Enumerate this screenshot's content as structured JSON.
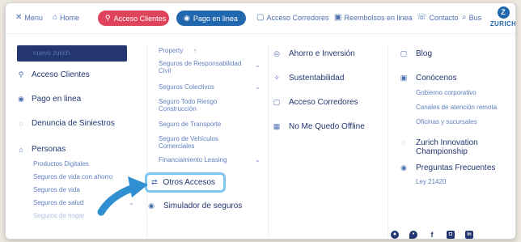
{
  "topbar": {
    "menu": "Menu",
    "home": "Home",
    "acceso_clientes": "Acceso Clientes",
    "pago_en_linea": "Pago en linea",
    "acceso_corredores": "Acceso Corredores",
    "reembolsos": "Reembolsos en linea",
    "contacto": "Contacto",
    "buscar": "Bus",
    "logo_text": "ZURICH"
  },
  "col1": {
    "header_label": "nuevo zurich",
    "items": [
      {
        "label": "Acceso Clientes",
        "icon": "person-icon"
      },
      {
        "label": "Pago en linea",
        "icon": "card-icon"
      },
      {
        "label": "Denuncia de Siniestros",
        "icon": "shield-icon"
      },
      {
        "label": "Personas",
        "icon": "people-icon"
      }
    ],
    "subitems": [
      "Productos Digitales",
      "Seguros de vida con ahorro",
      "Seguros de vida",
      "Seguros de salud",
      "Seguros de hogar"
    ]
  },
  "col2": {
    "items": [
      "Property",
      "Seguros de Responsabilidad Civil",
      "Seguros Colectivos",
      "Seguro Todo Riesgo Construcción",
      "Seguro de Transporte",
      "Seguro de Vehículos Comerciales",
      "Financiamiento Leasing"
    ],
    "otros_accesos": "Otros Accesos",
    "simulador": "Simulador de seguros"
  },
  "col3": {
    "items": [
      "Ahorro e Inversión",
      "Sustentabilidad",
      "Acceso Corredores",
      "No Me Quedo Offline"
    ]
  },
  "col4": {
    "blog": "Blog",
    "conocenos": "Conócenos",
    "conocenos_sub": [
      "Gobierno corporativo",
      "Canales de atención remota",
      "Oficinas y sucursales"
    ],
    "innovation": "Zurich Innovation Championship",
    "preguntas": "Preguntas Frecuentes",
    "ley": "Ley 21420"
  },
  "colors": {
    "accent_red": "#e0445c",
    "brand_blue": "#2167ae",
    "navy": "#23366f",
    "highlight": "#7ec6ee"
  }
}
